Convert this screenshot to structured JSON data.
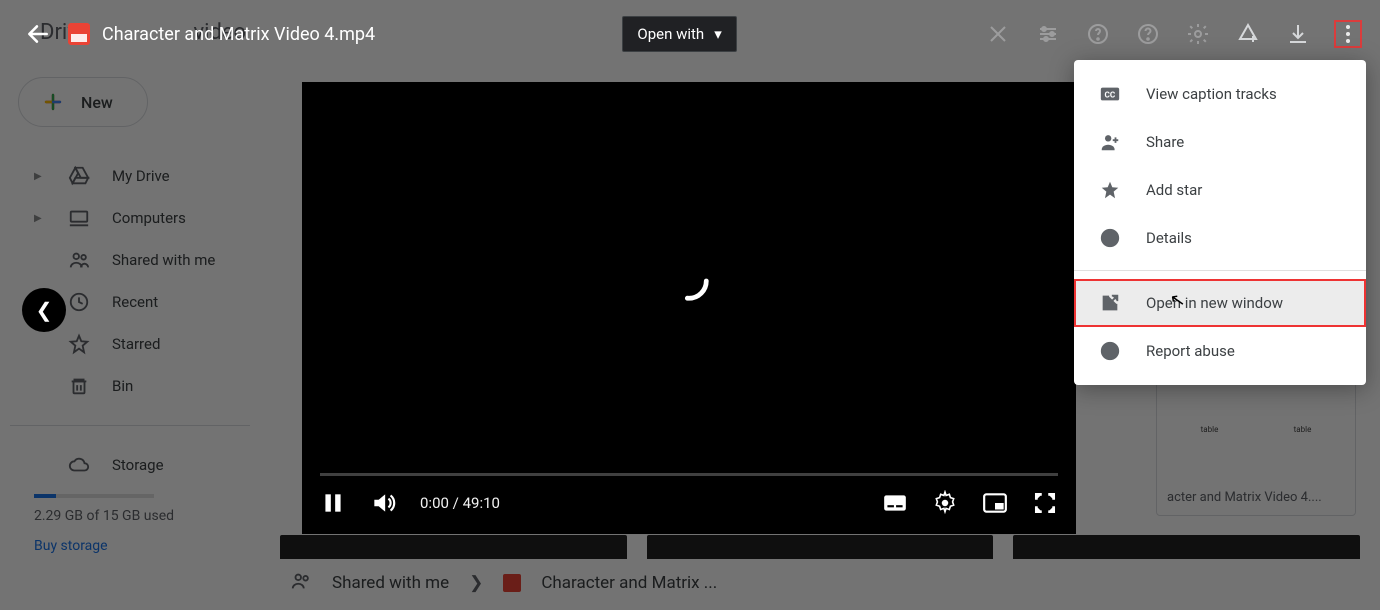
{
  "file": {
    "name": "Character and Matrix Video 4.mp4"
  },
  "open_with_label": "Open with",
  "search_hint": "video",
  "drive_logo": "Drive",
  "sidebar": {
    "new_label": "New",
    "items": [
      {
        "label": "My Drive"
      },
      {
        "label": "Computers"
      },
      {
        "label": "Shared with me"
      },
      {
        "label": "Recent"
      },
      {
        "label": "Starred"
      },
      {
        "label": "Bin"
      }
    ],
    "storage_label": "Storage",
    "storage_used": "2.29 GB of 15 GB used",
    "buy_storage": "Buy storage"
  },
  "related_tile": {
    "caption": "acter and Matrix Video 4...."
  },
  "breadcrumb": {
    "root": "Shared with me",
    "leaf": "Character and Matrix ..."
  },
  "player": {
    "time_current": "0:00",
    "time_total": "49:10"
  },
  "menu": {
    "view_captions": "View caption tracks",
    "share": "Share",
    "add_star": "Add star",
    "details": "Details",
    "open_new_window": "Open in new window",
    "report_abuse": "Report abuse"
  }
}
